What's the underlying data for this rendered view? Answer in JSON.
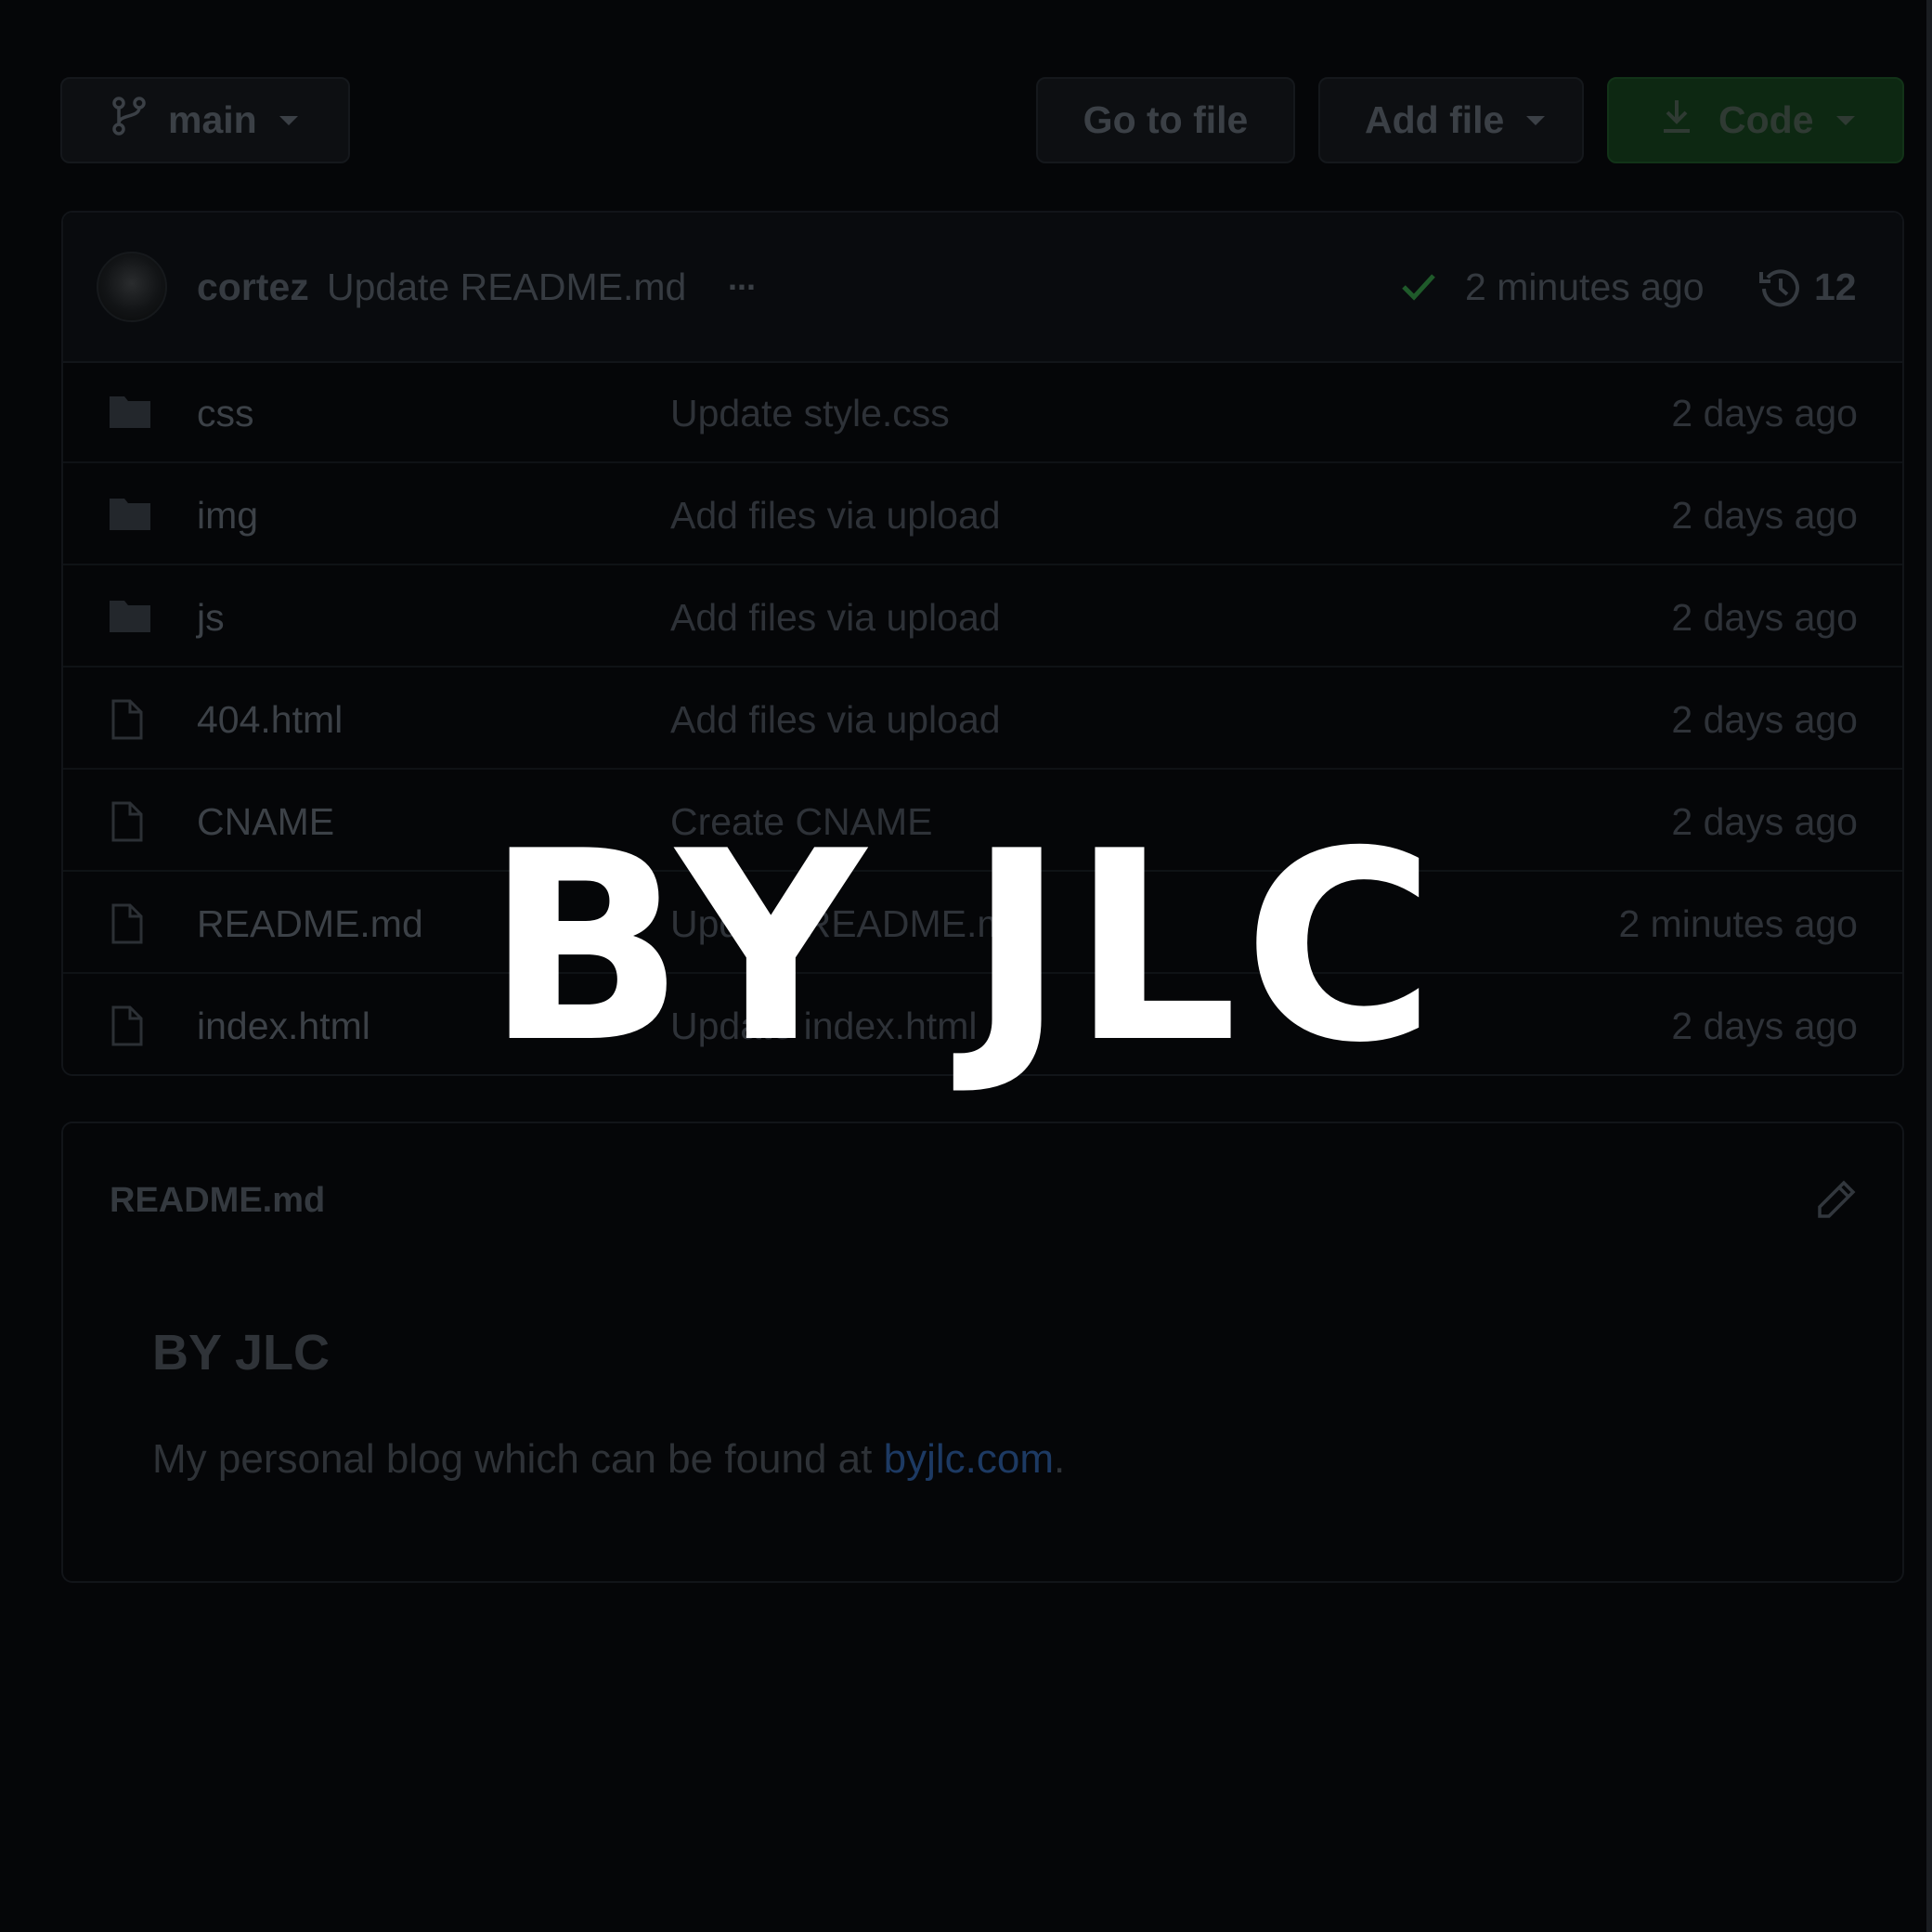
{
  "toolbar": {
    "branch_label": "main",
    "go_to_file_label": "Go to file",
    "add_file_label": "Add file",
    "code_label": "Code"
  },
  "latest_commit": {
    "author": "cortez",
    "message": "Update README.md",
    "more": "...",
    "time": "2 minutes ago",
    "commit_count": "12"
  },
  "files": [
    {
      "type": "folder",
      "name": "css",
      "message": "Update style.css",
      "time": "2 days ago"
    },
    {
      "type": "folder",
      "name": "img",
      "message": "Add files via upload",
      "time": "2 days ago"
    },
    {
      "type": "folder",
      "name": "js",
      "message": "Add files via upload",
      "time": "2 days ago"
    },
    {
      "type": "file",
      "name": "404.html",
      "message": "Add files via upload",
      "time": "2 days ago"
    },
    {
      "type": "file",
      "name": "CNAME",
      "message": "Create CNAME",
      "time": "2 days ago"
    },
    {
      "type": "file",
      "name": "README.md",
      "message": "Update README.md",
      "time": "2 minutes ago"
    },
    {
      "type": "file",
      "name": "index.html",
      "message": "Update index.html",
      "time": "2 days ago"
    }
  ],
  "readme": {
    "title": "README.md",
    "heading": "BY JLC",
    "body_prefix": "My personal blog which can be found at ",
    "link_text": "byjlc.com",
    "body_suffix": "."
  },
  "overlay": {
    "title": "BY JLC"
  },
  "colors": {
    "background": "#050608",
    "code_button": "#0d2812",
    "check": "#1f5a2a",
    "link": "#1d3a63",
    "overlay_text": "#ffffff"
  }
}
